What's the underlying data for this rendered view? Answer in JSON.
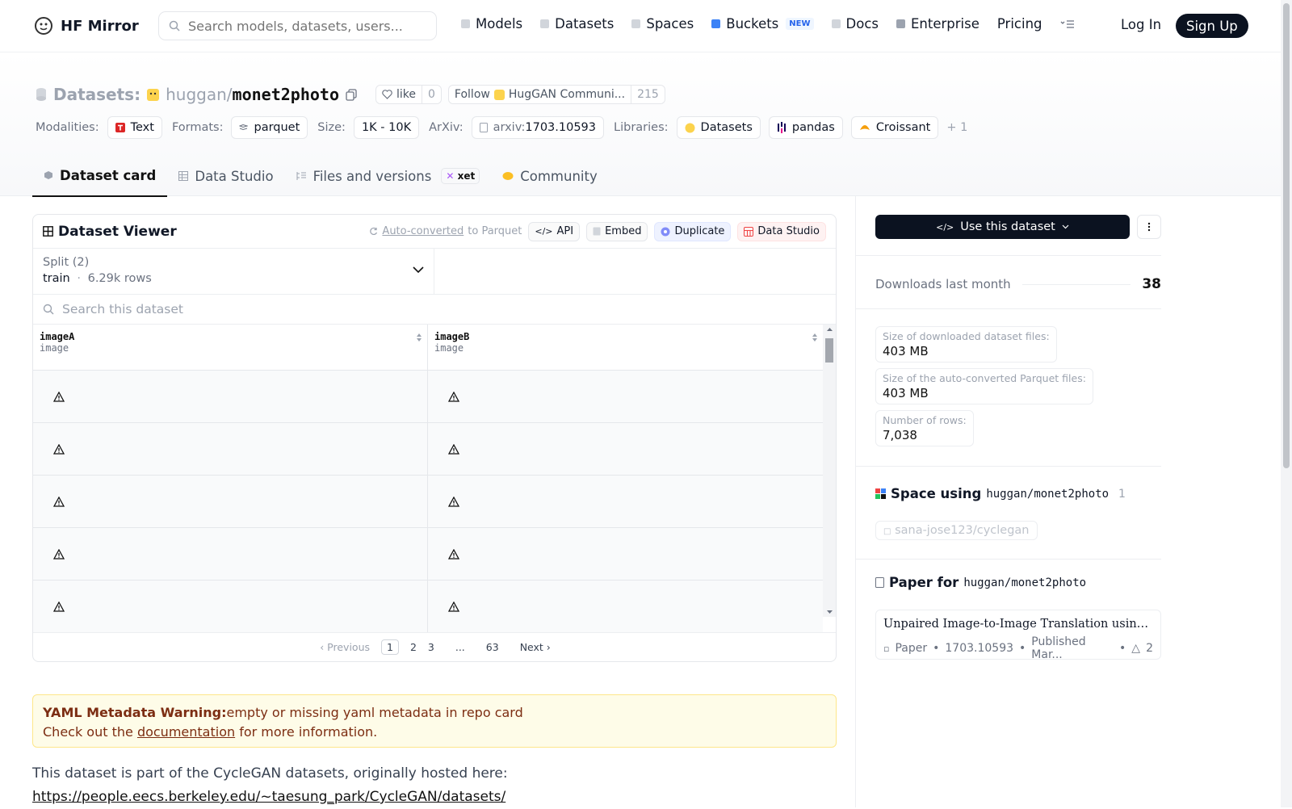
{
  "nav": {
    "brand": "HF Mirror",
    "search_placeholder": "Search models, datasets, users...",
    "links": [
      "Models",
      "Datasets",
      "Spaces",
      "Buckets",
      "Docs",
      "Enterprise",
      "Pricing"
    ],
    "new_badge": "NEW",
    "login": "Log In",
    "signup": "Sign Up"
  },
  "header": {
    "label": "Datasets:",
    "owner": "huggan",
    "slash": "/",
    "repo": "monet2photo",
    "like_label": "like",
    "like_count": "0",
    "follow_label": "Follow",
    "follow_org": "HugGAN Communi...",
    "follow_count": "215",
    "meta": {
      "modalities_label": "Modalities:",
      "modality": "Text",
      "formats_label": "Formats:",
      "format": "parquet",
      "size_label": "Size:",
      "size": "1K - 10K",
      "arxiv_label": "ArXiv:",
      "arxiv_prefix": "arxiv:",
      "arxiv": "1703.10593",
      "libraries_label": "Libraries:",
      "libraries": [
        "Datasets",
        "pandas",
        "Croissant"
      ],
      "more": "+ 1"
    },
    "tabs": [
      "Dataset card",
      "Data Studio",
      "Files and versions",
      "Community"
    ],
    "xet": "xet"
  },
  "viewer": {
    "title": "Dataset Viewer",
    "auto_converted": "Auto-converted",
    "to_parquet": "to Parquet",
    "api": "API",
    "embed": "Embed",
    "duplicate": "Duplicate",
    "data_studio": "Data Studio",
    "split_label": "Split (2)",
    "split_name": "train",
    "split_sep": "·",
    "split_rows": "6.29k rows",
    "search_placeholder": "Search this dataset",
    "columns": [
      {
        "name": "imageA",
        "type": "image"
      },
      {
        "name": "imageB",
        "type": "image"
      }
    ],
    "row_count_visible": 5,
    "pager": {
      "prev": "Previous",
      "pages": [
        "1",
        "2",
        "3",
        "...",
        "63"
      ],
      "next": "Next"
    }
  },
  "warning": {
    "bold": "YAML Metadata Warning:",
    "text": "empty or missing yaml metadata in repo card",
    "line2_pre": "Check out the ",
    "link": "documentation",
    "line2_post": " for more information."
  },
  "body": {
    "text": "This dataset is part of the CycleGAN datasets, originally hosted here:",
    "url": "https://people.eecs.berkeley.edu/~taesung_park/CycleGAN/datasets/"
  },
  "sidebar": {
    "use_label": "Use this dataset",
    "downloads_label": "Downloads last month",
    "downloads": "38",
    "stats": [
      {
        "label": "Size of downloaded dataset files:",
        "value": "403 MB"
      },
      {
        "label": "Size of the auto-converted Parquet files:",
        "value": "403 MB"
      },
      {
        "label": "Number of rows:",
        "value": "7,038"
      }
    ],
    "space_title": "Space using",
    "space_repo": "huggan/monet2photo",
    "space_count": "1",
    "space_item": "sana-jose123/cyclegan",
    "paper_title": "Paper for",
    "paper_repo": "huggan/monet2photo",
    "paper_name": "Unpaired Image-to-Image Translation using Cycle-Consistent Adversarial Networks",
    "paper_kind": "Paper",
    "paper_id": "1703.10593",
    "paper_pub": "Published Mar...",
    "paper_votes": "2"
  }
}
